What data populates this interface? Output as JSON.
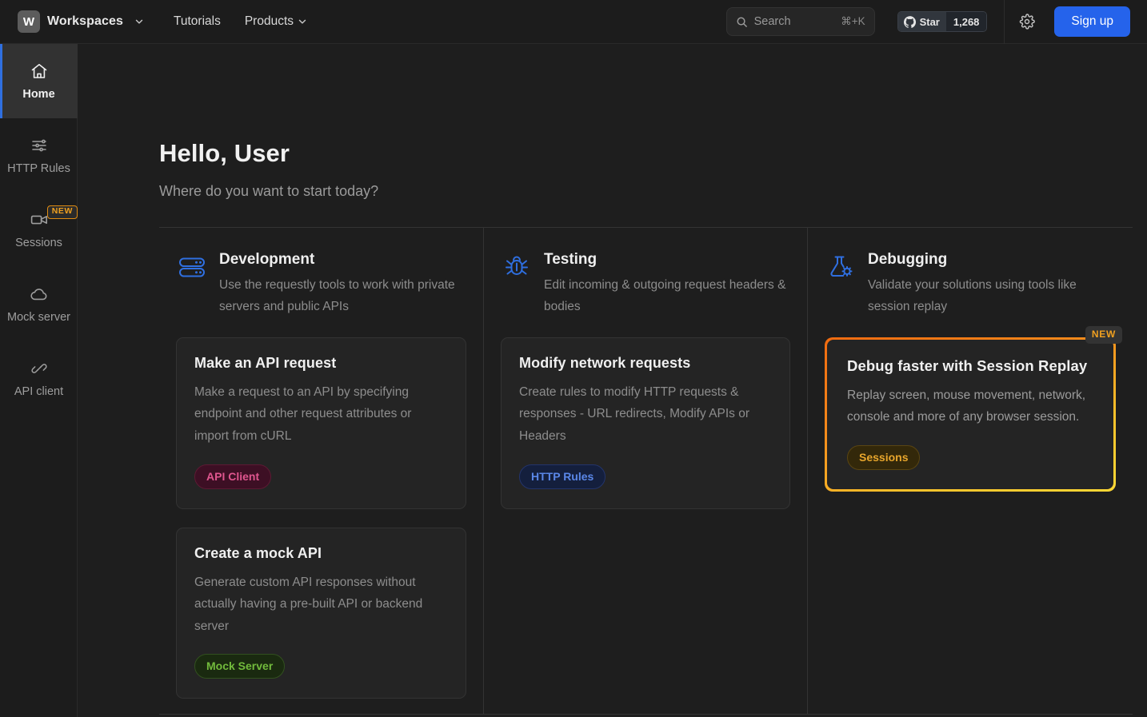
{
  "topbar": {
    "workspace_badge": "W",
    "workspace_label": "Workspaces",
    "nav": [
      {
        "label": "Tutorials",
        "has_chevron": false
      },
      {
        "label": "Products",
        "has_chevron": true
      }
    ],
    "search": {
      "placeholder": "Search",
      "value": "",
      "shortcut": "⌘+K"
    },
    "github": {
      "label": "Star",
      "count": "1,268"
    },
    "settings_icon": "gear-icon",
    "signup_label": "Sign up"
  },
  "sidebar": {
    "items": [
      {
        "label": "Home",
        "icon": "home-icon",
        "active": true,
        "badge": ""
      },
      {
        "label": "HTTP Rules",
        "icon": "sliders-icon",
        "active": false,
        "badge": ""
      },
      {
        "label": "Sessions",
        "icon": "video-icon",
        "active": false,
        "badge": "NEW"
      },
      {
        "label": "Mock server",
        "icon": "cloud-icon",
        "active": false,
        "badge": ""
      },
      {
        "label": "API client",
        "icon": "connector-icon",
        "active": false,
        "badge": ""
      }
    ]
  },
  "main": {
    "greeting_title": "Hello, User",
    "greeting_subtitle": "Where do you want to start today?",
    "columns": [
      {
        "icon": "server-rack-icon",
        "title": "Development",
        "description": "Use the requestly tools to work with private servers and public APIs",
        "cards": [
          {
            "title": "Make an API request",
            "description": "Make a request to an API by specifying endpoint and other request attributes or import from cURL",
            "badge": "API Client",
            "badge_style": "pink",
            "highlighted": false,
            "ribbon": ""
          },
          {
            "title": "Create a mock API",
            "description": "Generate custom API responses without actually having a pre-built API or backend server",
            "badge": "Mock Server",
            "badge_style": "green",
            "highlighted": false,
            "ribbon": ""
          }
        ]
      },
      {
        "icon": "bug-icon",
        "title": "Testing",
        "description": "Edit incoming & outgoing request headers & bodies",
        "cards": [
          {
            "title": "Modify network requests",
            "description": "Create rules to modify HTTP requests & responses - URL redirects, Modify APIs or Headers",
            "badge": "HTTP Rules",
            "badge_style": "blue",
            "highlighted": false,
            "ribbon": ""
          }
        ]
      },
      {
        "icon": "flask-gear-icon",
        "title": "Debugging",
        "description": "Validate your solutions using tools like session replay",
        "cards": [
          {
            "title": "Debug faster with Session Replay",
            "description": "Replay screen, mouse movement, network, console and more of any browser session.",
            "badge": "Sessions",
            "badge_style": "amber",
            "highlighted": true,
            "ribbon": "NEW"
          }
        ]
      }
    ]
  },
  "colors": {
    "accent_blue": "#2563eb",
    "icon_blue": "#2f6fe0",
    "highlight_orange": "#f06a10",
    "highlight_yellow": "#fdd835",
    "badge_new": "#f0a020",
    "page_bg": "#1e1e1e",
    "panel_bg": "#1c1c1c",
    "card_bg": "#242424"
  }
}
